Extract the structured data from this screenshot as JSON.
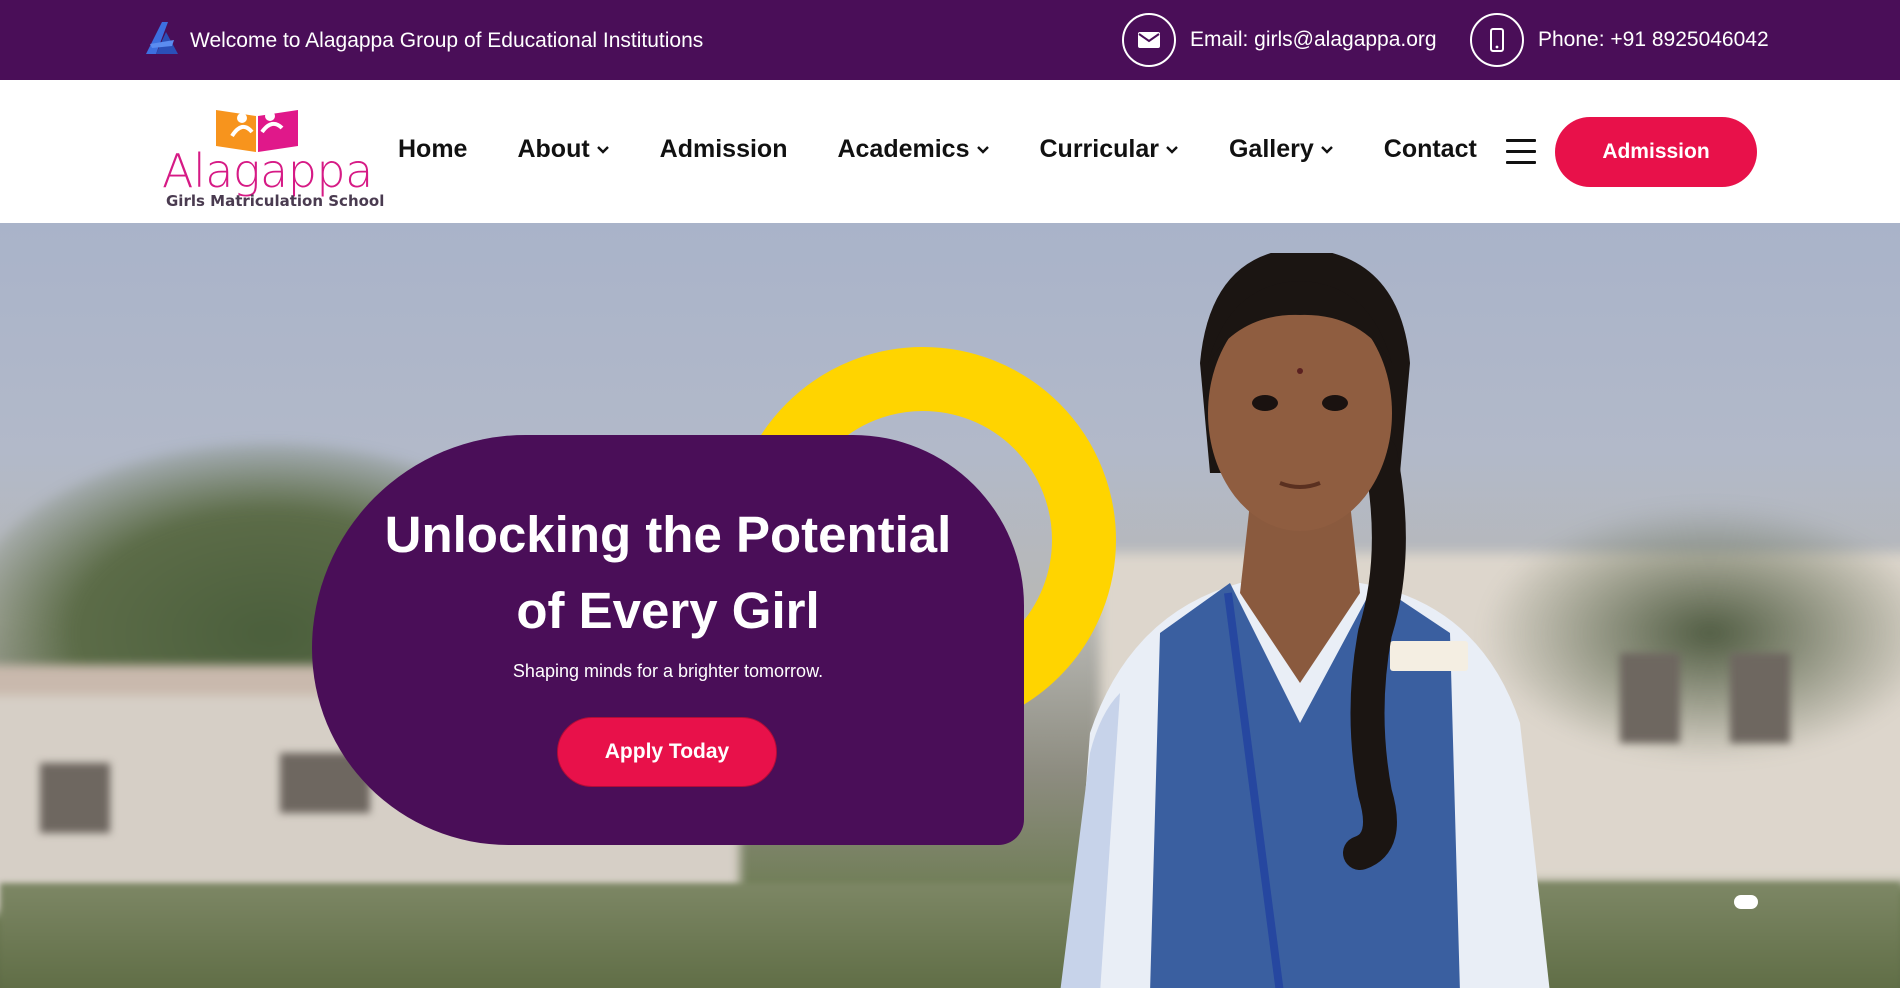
{
  "topbar": {
    "welcome_text": "Welcome to Alagappa Group of Educational Institutions",
    "email_text": "Email: girls@alagappa.org",
    "phone_text": "Phone: +91 8925046042",
    "icons": [
      "alagappa-a-logo-icon",
      "envelope-icon",
      "mobile-phone-icon"
    ]
  },
  "header": {
    "logo": {
      "name": "Alagappa",
      "subtitle": "Girls Matriculation School"
    },
    "nav": [
      {
        "label": "Home",
        "has_dropdown": false
      },
      {
        "label": "About",
        "has_dropdown": true
      },
      {
        "label": "Admission",
        "has_dropdown": false
      },
      {
        "label": "Academics",
        "has_dropdown": true
      },
      {
        "label": "Curricular",
        "has_dropdown": true
      },
      {
        "label": "Gallery",
        "has_dropdown": true
      },
      {
        "label": "Contact",
        "has_dropdown": false
      }
    ],
    "admission_button": "Admission"
  },
  "hero": {
    "title_line1": "Unlocking the Potential",
    "title_line2": "of Every Girl",
    "subtitle": "Shaping minds for a brighter tomorrow.",
    "cta": "Apply Today",
    "active_slide": 1
  },
  "colors": {
    "brand_purple": "#4a0e58",
    "accent_red": "#e8114a",
    "accent_yellow": "#ffd400",
    "logo_pink": "#d61a85"
  }
}
